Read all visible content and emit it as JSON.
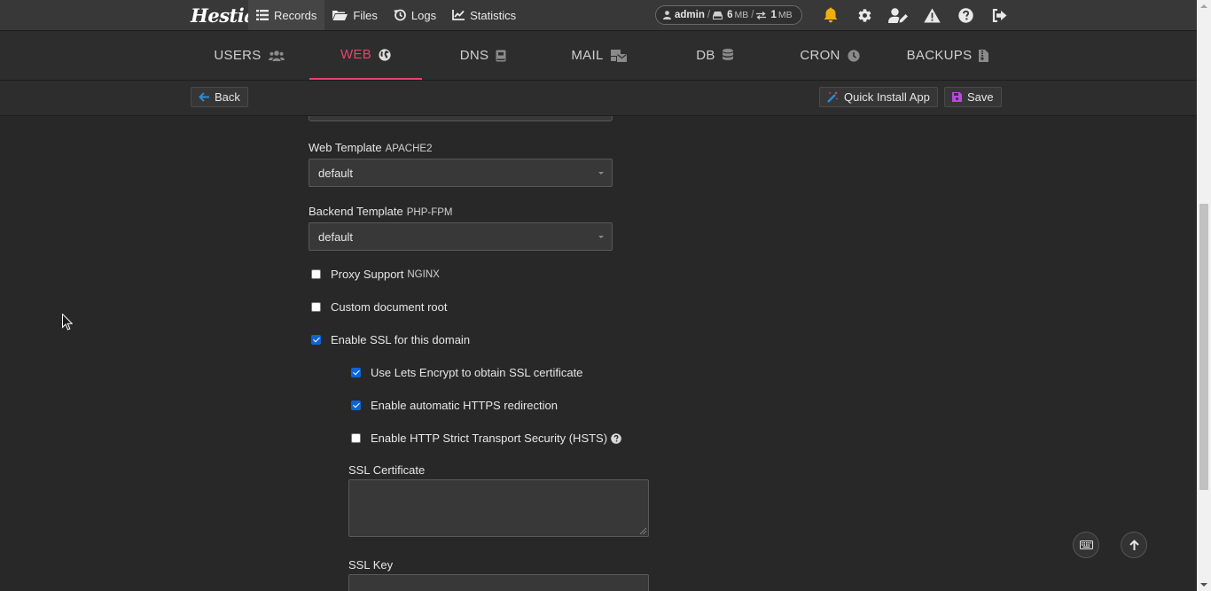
{
  "brand": {
    "logo_text": "Hestia"
  },
  "topnav": [
    {
      "label": "Records",
      "icon": "list-icon",
      "active": true
    },
    {
      "label": "Files",
      "icon": "folder-icon"
    },
    {
      "label": "Logs",
      "icon": "history-icon"
    },
    {
      "label": "Statistics",
      "icon": "chart-line-icon"
    }
  ],
  "usage": {
    "user": "admin",
    "sep": "/",
    "disk_value": "6",
    "disk_unit": "MB",
    "bw_sep": "/",
    "bw_value": "1",
    "bw_unit": "MB"
  },
  "top_icons": [
    "bell-icon",
    "gear-icon",
    "user-edit-icon",
    "warning-icon",
    "help-icon",
    "logout-icon"
  ],
  "tabs": [
    {
      "label": "USERS",
      "icon": "users-icon"
    },
    {
      "label": "WEB",
      "icon": "globe-icon",
      "active": true
    },
    {
      "label": "DNS",
      "icon": "book-icon"
    },
    {
      "label": "MAIL",
      "icon": "mail-bulk-icon"
    },
    {
      "label": "DB",
      "icon": "database-icon"
    },
    {
      "label": "CRON",
      "icon": "clock-icon"
    },
    {
      "label": "BACKUPS",
      "icon": "file-archive-icon"
    }
  ],
  "toolbar": {
    "back_label": "Back",
    "quick_install_label": "Quick Install App",
    "save_label": "Save"
  },
  "form": {
    "web_template": {
      "label": "Web Template",
      "hint": "APACHE2",
      "value": "default"
    },
    "backend_template": {
      "label": "Backend Template",
      "hint": "PHP-FPM",
      "value": "default"
    },
    "proxy_support": {
      "label": "Proxy Support",
      "hint": "NGINX",
      "checked": false
    },
    "custom_docroot": {
      "label": "Custom document root",
      "checked": false
    },
    "enable_ssl": {
      "label": "Enable SSL for this domain",
      "checked": true
    },
    "letsencrypt": {
      "label": "Use Lets Encrypt to obtain SSL certificate",
      "checked": true
    },
    "https_redirect": {
      "label": "Enable automatic HTTPS redirection",
      "checked": true
    },
    "hsts": {
      "label": "Enable HTTP Strict Transport Security (HSTS)",
      "checked": false
    },
    "ssl_certificate": {
      "label": "SSL Certificate",
      "value": ""
    },
    "ssl_key": {
      "label": "SSL Key",
      "value": ""
    }
  },
  "colors": {
    "accent": "#e6456e",
    "checkbox": "#0a64d8",
    "background": "#282828",
    "topbar": "#383838"
  }
}
